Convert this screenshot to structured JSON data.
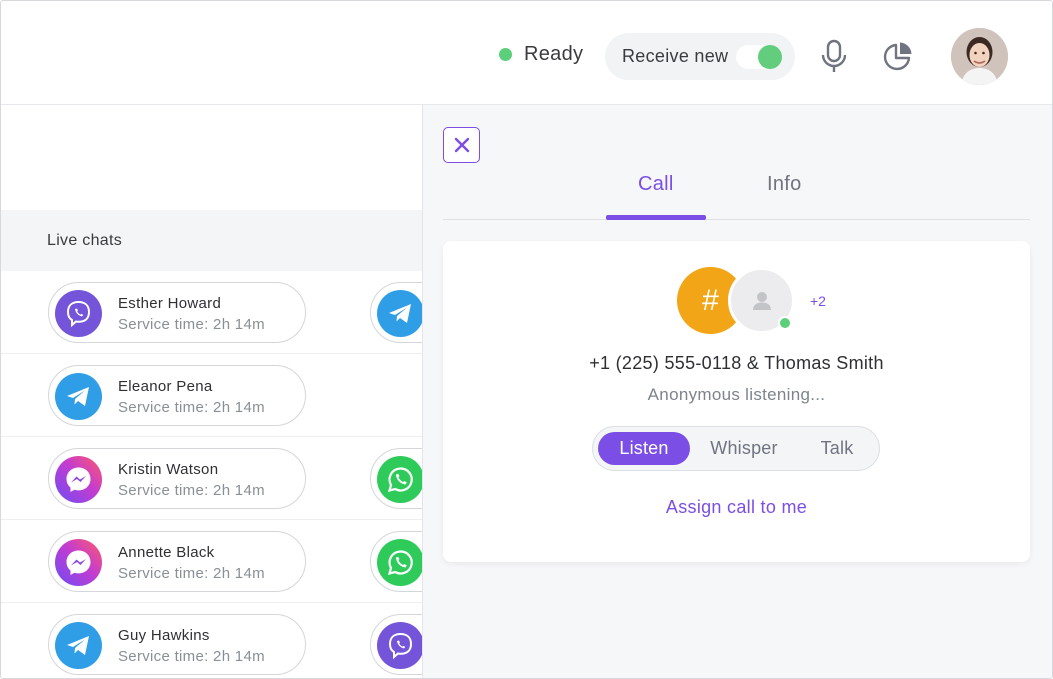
{
  "header": {
    "status_label": "Ready",
    "receive_label": "Receive new",
    "receive_toggle_on": true,
    "icons": [
      "microphone-icon",
      "pie-chart-icon",
      "avatar"
    ]
  },
  "live_chats": {
    "title": "Live chats",
    "rows": [
      {
        "name": "Esther Howard",
        "service_time": "Service time: 2h 14m",
        "channel": "viber",
        "extra_channel": "telegram"
      },
      {
        "name": "Eleanor Pena",
        "service_time": "Service time: 2h 14m",
        "channel": "telegram",
        "extra_channel": ""
      },
      {
        "name": "Kristin Watson",
        "service_time": "Service time: 2h 14m",
        "channel": "messenger",
        "extra_channel": "whatsapp"
      },
      {
        "name": "Annette Black",
        "service_time": "Service time: 2h 14m",
        "channel": "messenger",
        "extra_channel": "whatsapp"
      },
      {
        "name": "Guy Hawkins",
        "service_time": "Service time: 2h 14m",
        "channel": "telegram",
        "extra_channel": "viber"
      }
    ]
  },
  "call_panel": {
    "tabs": [
      {
        "label": "Call",
        "active": true
      },
      {
        "label": "Info",
        "active": false
      }
    ],
    "hash_symbol": "#",
    "extra_participants": "+2",
    "caller": "+1 (225) 555-0118 & Thomas Smith",
    "status": "Anonymous listening...",
    "modes": [
      "Listen",
      "Whisper",
      "Talk"
    ],
    "active_mode": "Listen",
    "assign_label": "Assign call to me"
  },
  "colors": {
    "accent": "#7b4ee6",
    "online": "#5ccf7b",
    "hash_avatar": "#f2a516"
  }
}
